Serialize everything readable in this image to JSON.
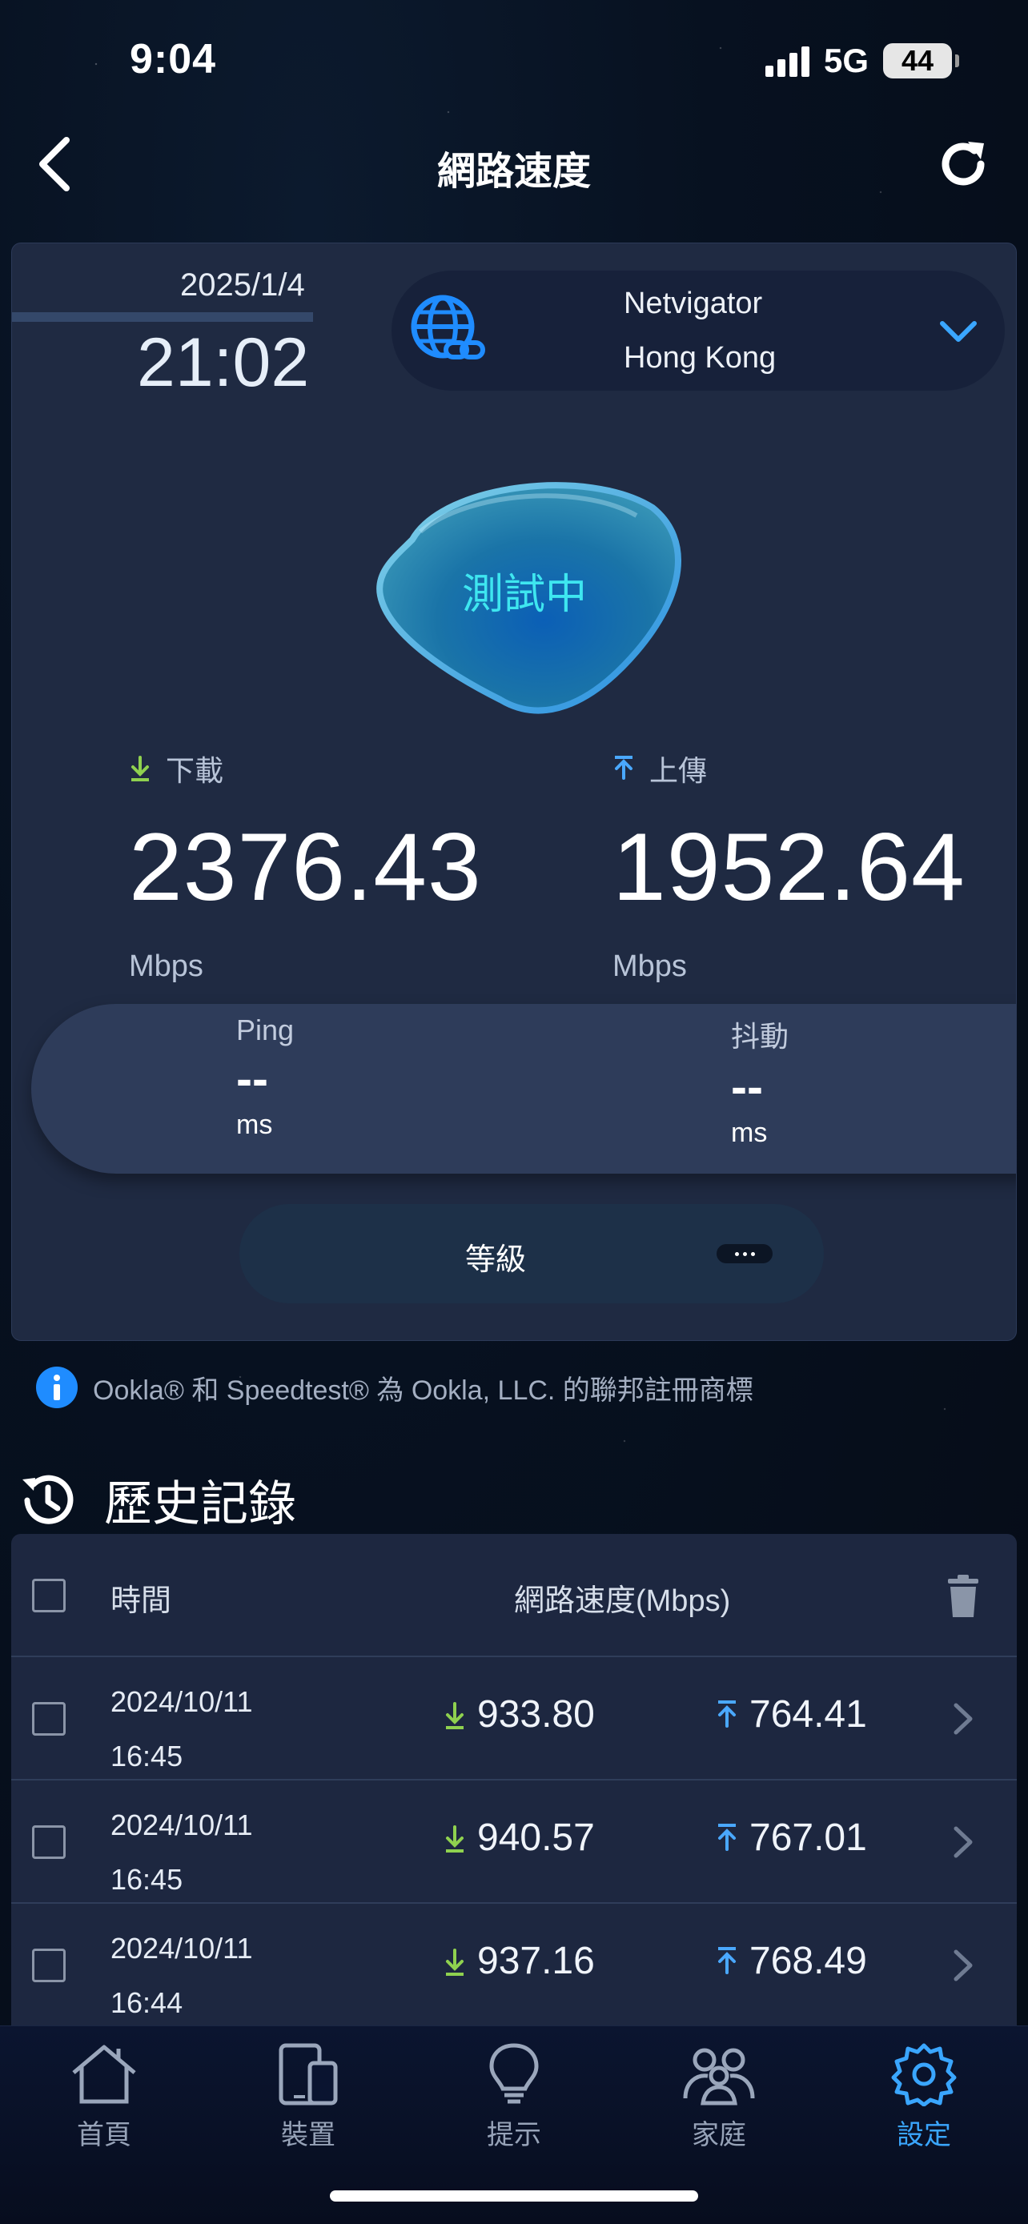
{
  "status_bar": {
    "time": "9:04",
    "network": "5G",
    "battery": "44"
  },
  "header": {
    "title": "網路速度"
  },
  "test": {
    "date": "2025/1/4",
    "time": "21:02",
    "server_name": "Netvigator",
    "server_location": "Hong Kong",
    "status_label": "測試中",
    "download_label": "下載",
    "download_value": "2376.43",
    "download_unit": "Mbps",
    "upload_label": "上傳",
    "upload_value": "1952.64",
    "upload_unit": "Mbps",
    "ping_label": "Ping",
    "ping_value": "--",
    "ping_unit": "ms",
    "jitter_label": "抖動",
    "jitter_value": "--",
    "jitter_unit": "ms",
    "grade_label": "等級"
  },
  "notice": "Ookla® 和 Speedtest® 為 Ookla, LLC. 的聯邦註冊商標",
  "history": {
    "title": "歷史記錄",
    "col_time": "時間",
    "col_speed": "網路速度(Mbps)",
    "rows": [
      {
        "date": "2024/10/11",
        "time": "16:45",
        "download": "933.80",
        "upload": "764.41"
      },
      {
        "date": "2024/10/11",
        "time": "16:45",
        "download": "940.57",
        "upload": "767.01"
      },
      {
        "date": "2024/10/11",
        "time": "16:44",
        "download": "937.16",
        "upload": "768.49"
      }
    ]
  },
  "tabs": [
    {
      "label": "首頁",
      "icon": "home-icon"
    },
    {
      "label": "裝置",
      "icon": "devices-icon"
    },
    {
      "label": "提示",
      "icon": "lightbulb-icon"
    },
    {
      "label": "家庭",
      "icon": "family-icon"
    },
    {
      "label": "設定",
      "icon": "settings-icon",
      "active": true
    }
  ],
  "colors": {
    "accent": "#3aa6ff",
    "download_arrow": "#8fd14f",
    "upload_arrow": "#4aa8ff",
    "status_text": "#3ee6f0"
  }
}
